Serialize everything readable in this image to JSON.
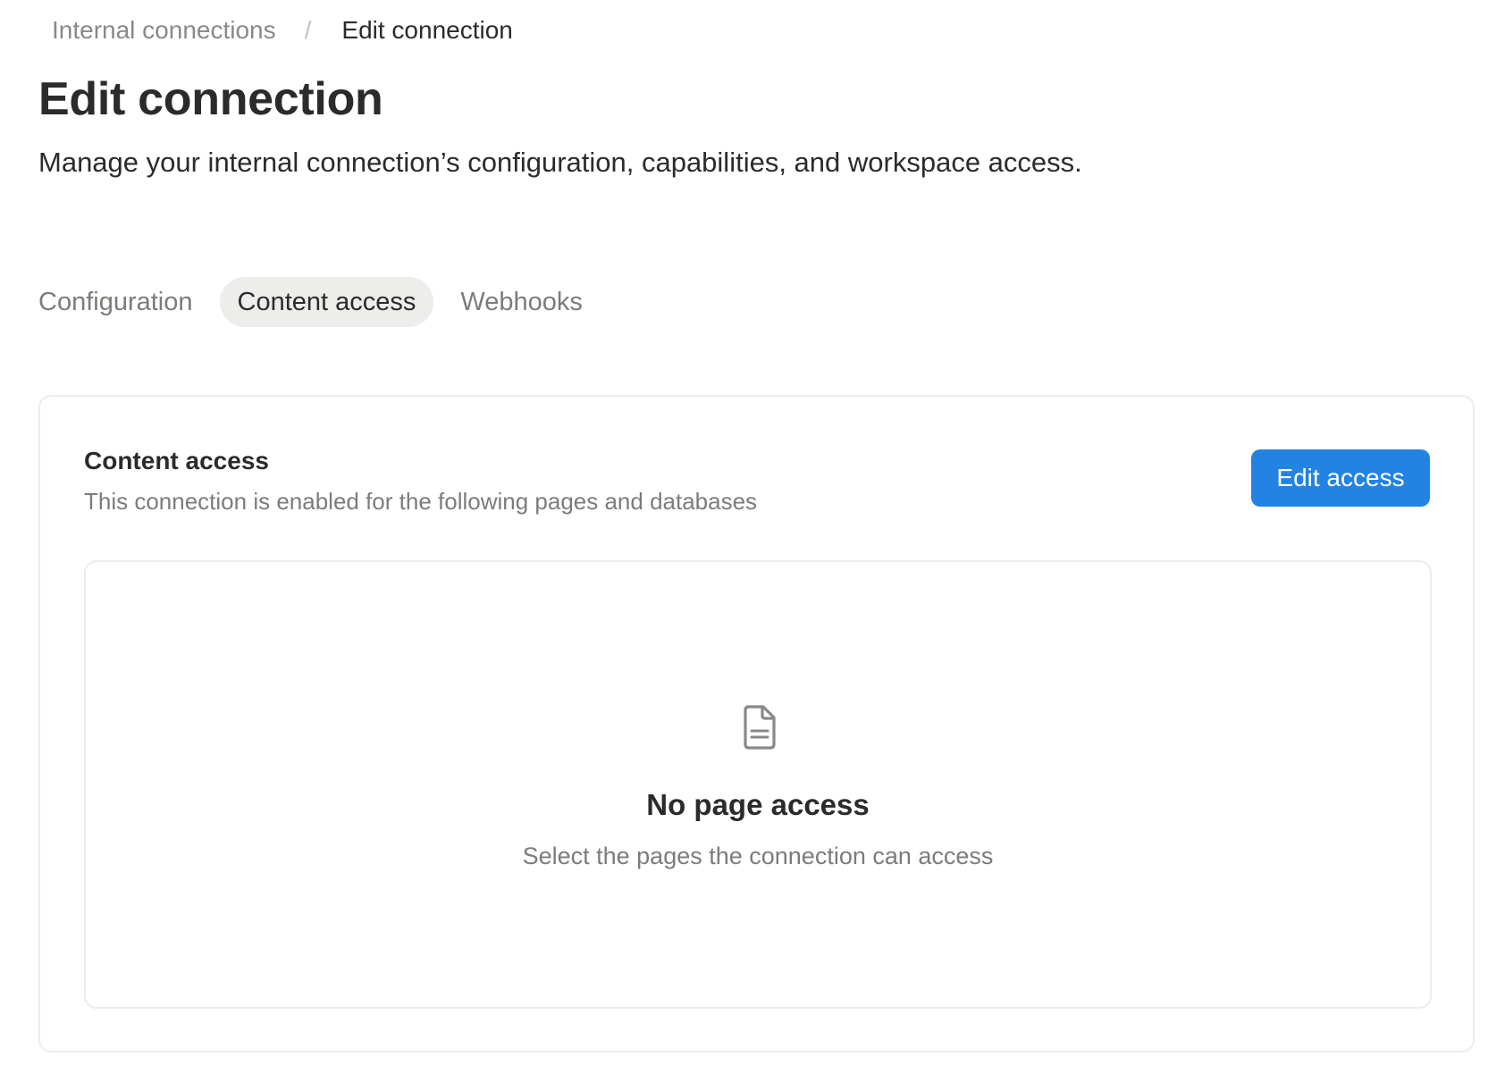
{
  "breadcrumb": {
    "parent": "Internal connections",
    "separator": "/",
    "current": "Edit connection"
  },
  "header": {
    "title": "Edit connection",
    "subtitle": "Manage your internal connection’s configuration, capabilities, and workspace access."
  },
  "tabs": [
    {
      "label": "Configuration",
      "active": false
    },
    {
      "label": "Content access",
      "active": true
    },
    {
      "label": "Webhooks",
      "active": false
    }
  ],
  "content_access": {
    "title": "Content access",
    "description": "This connection is enabled for the following pages and databases",
    "edit_button_label": "Edit access",
    "empty_state": {
      "icon": "document-icon",
      "title": "No page access",
      "description": "Select the pages the connection can access"
    }
  },
  "colors": {
    "accent": "#2383e2",
    "active_tab_bg": "#ededeb",
    "muted_text": "#7d7c79",
    "primary_text": "#2b2b2b",
    "border": "#ececea"
  }
}
